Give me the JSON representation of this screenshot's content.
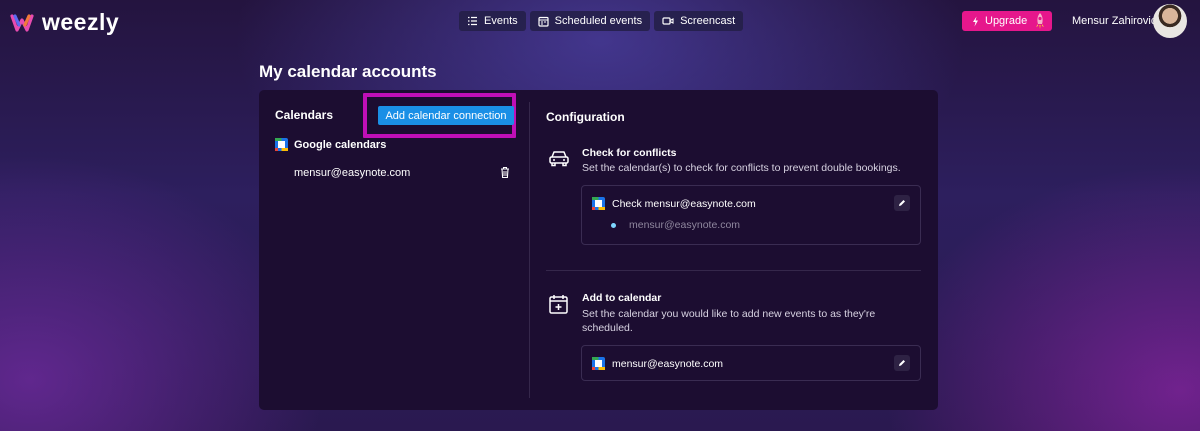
{
  "brand": {
    "name": "weezly"
  },
  "nav": {
    "items": [
      {
        "label": "Events",
        "icon": "list-icon"
      },
      {
        "label": "Scheduled events",
        "icon": "calendar-icon"
      },
      {
        "label": "Screencast",
        "icon": "video-icon"
      }
    ]
  },
  "header": {
    "upgrade_label": "Upgrade",
    "user_name": "Mensur Zahirovic"
  },
  "page": {
    "title": "My calendar accounts"
  },
  "calendars": {
    "title": "Calendars",
    "add_button": "Add calendar connection",
    "group_label": "Google calendars",
    "accounts": [
      {
        "email": "mensur@easynote.com"
      }
    ]
  },
  "configuration": {
    "title": "Configuration",
    "conflicts": {
      "title": "Check for conflicts",
      "description": "Set the calendar(s) to check for conflicts to prevent double bookings.",
      "entry_label": "Check mensur@easynote.com",
      "sub_calendar": "mensur@easynote.com"
    },
    "add_to": {
      "title": "Add to calendar",
      "description_line1": "Set the calendar you would like to add new events to as they're",
      "description_line2": "scheduled.",
      "calendar": "mensur@easynote.com"
    }
  },
  "colors": {
    "accent_blue": "#1a8fe6",
    "upgrade_pink": "#e6178c",
    "highlight_magenta": "#c00fb7",
    "card_bg": "#1c0d31"
  }
}
